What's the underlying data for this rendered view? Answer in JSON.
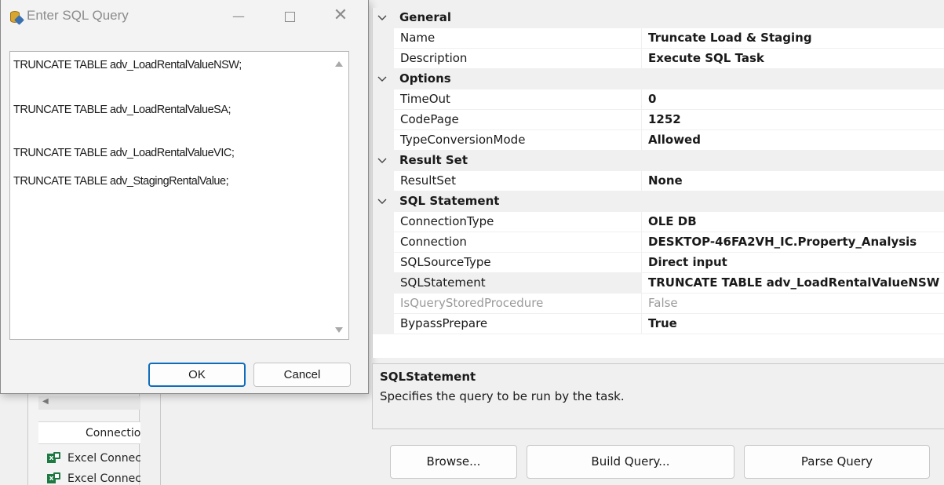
{
  "dialog": {
    "title": "Enter SQL Query",
    "query_lines": [
      "TRUNCATE TABLE adv_LoadRentalValueNSW;",
      "TRUNCATE TABLE adv_LoadRentalValueSA;",
      "TRUNCATE TABLE adv_LoadRentalValueVIC;",
      "TRUNCATE TABLE adv_StagingRentalValue;"
    ],
    "ok_label": "OK",
    "cancel_label": "Cancel",
    "minimize_glyph": "—",
    "close_glyph": "✕"
  },
  "background": {
    "connections_header": "Connections",
    "connections": [
      "Excel Connection",
      "Excel Connection"
    ]
  },
  "properties": {
    "categories": [
      {
        "label": "General",
        "expanded": true,
        "rows": [
          {
            "name": "Name",
            "value": "Truncate Load & Staging"
          },
          {
            "name": "Description",
            "value": "Execute SQL Task"
          }
        ]
      },
      {
        "label": "Options",
        "expanded": true,
        "rows": [
          {
            "name": "TimeOut",
            "value": "0"
          },
          {
            "name": "CodePage",
            "value": "1252"
          },
          {
            "name": "TypeConversionMode",
            "value": "Allowed"
          }
        ]
      },
      {
        "label": "Result Set",
        "expanded": true,
        "rows": [
          {
            "name": "ResultSet",
            "value": "None"
          }
        ]
      },
      {
        "label": "SQL Statement",
        "expanded": true,
        "rows": [
          {
            "name": "ConnectionType",
            "value": "OLE DB"
          },
          {
            "name": "Connection",
            "value": "DESKTOP-46FA2VH_IC.Property_Analysis"
          },
          {
            "name": "SQLSourceType",
            "value": "Direct input"
          },
          {
            "name": "SQLStatement",
            "value": "TRUNCATE TABLE adv_LoadRentalValueNSW",
            "selected": true
          },
          {
            "name": "IsQueryStoredProcedure",
            "value": "False",
            "disabled": true
          },
          {
            "name": "BypassPrepare",
            "value": "True"
          }
        ]
      }
    ]
  },
  "description": {
    "title": "SQLStatement",
    "text": "Specifies the query to be run by the task."
  },
  "buttons": {
    "browse": "Browse...",
    "build_query": "Build Query...",
    "parse_query": "Parse Query"
  },
  "colors": {
    "accent": "#0f6cbd",
    "category_bg": "#f0f0f0",
    "disabled_text": "#9a9a9a"
  }
}
